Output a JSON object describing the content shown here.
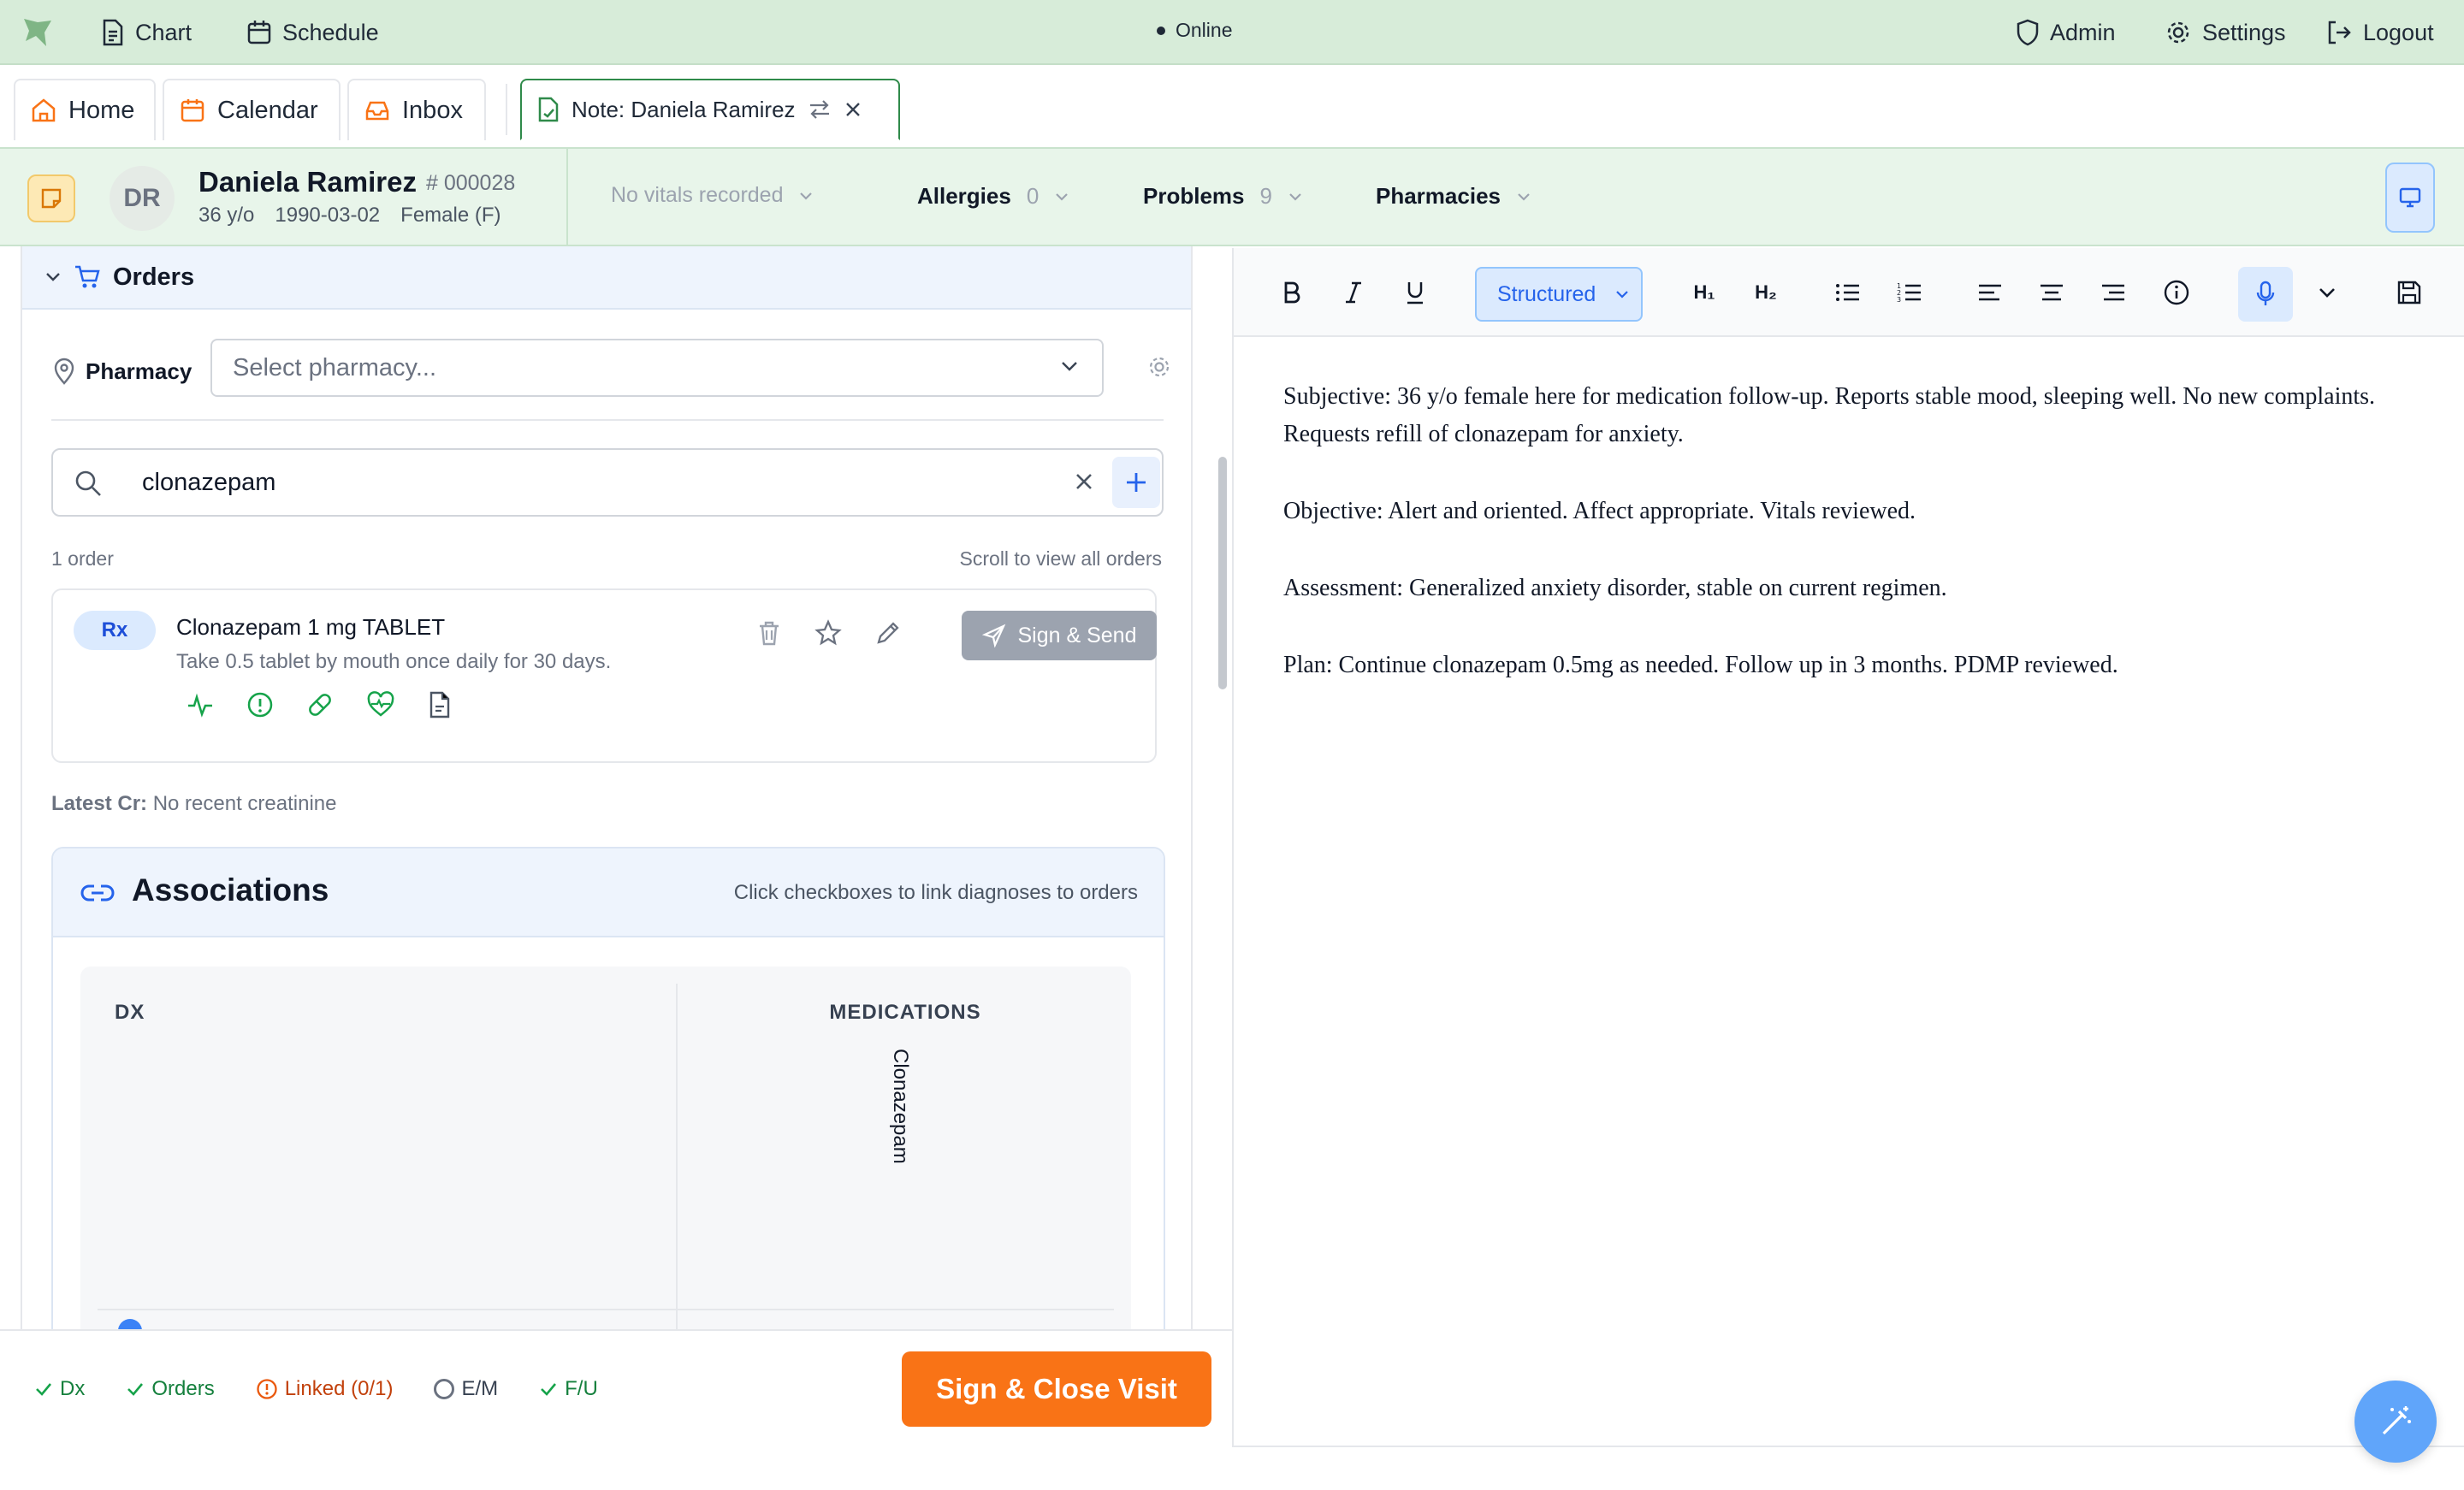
{
  "topbar": {
    "nav": [
      {
        "label": "Chart",
        "icon": "file-text-icon"
      },
      {
        "label": "Schedule",
        "icon": "calendar-icon"
      }
    ],
    "status": "Online",
    "right": [
      {
        "label": "Admin",
        "icon": "shield-icon"
      },
      {
        "label": "Settings",
        "icon": "gear-icon"
      },
      {
        "label": "Logout",
        "icon": "logout-icon"
      }
    ]
  },
  "tabs": [
    {
      "label": "Home",
      "icon": "home-icon"
    },
    {
      "label": "Calendar",
      "icon": "calendar-icon"
    },
    {
      "label": "Inbox",
      "icon": "inbox-icon"
    },
    {
      "label": "Note: Daniela Ramirez",
      "icon": "note-icon",
      "active": true
    }
  ],
  "patient": {
    "initials": "DR",
    "name": "Daniela Ramirez",
    "id": "# 000028",
    "age": "36 y/o",
    "dob": "1990-03-02",
    "sex": "Female (F)",
    "vitals": "No vitals recorded",
    "allergies": {
      "label": "Allergies",
      "count": "0"
    },
    "problems": {
      "label": "Problems",
      "count": "9"
    },
    "pharmacies": {
      "label": "Pharmacies"
    }
  },
  "orders": {
    "title": "Orders",
    "pharmacy_label": "Pharmacy",
    "pharmacy_placeholder": "Select pharmacy...",
    "search_value": "clonazepam",
    "count": "1 order",
    "scroll_hint": "Scroll to view all orders",
    "items": [
      {
        "badge": "Rx",
        "drug": "Clonazepam 1 mg TABLET",
        "sig": "Take 0.5 tablet by mouth once daily for 30 days.",
        "action": "Sign & Send"
      }
    ],
    "latest_cr_label": "Latest Cr:",
    "latest_cr_value": "No recent creatinine"
  },
  "associations": {
    "title": "Associations",
    "hint": "Click checkboxes to link diagnoses to orders",
    "col_dx": "DX",
    "col_medications": "MEDICATIONS",
    "medications": [
      "Clonazepam"
    ]
  },
  "footer": {
    "checks": [
      {
        "label": "Dx",
        "state": "done"
      },
      {
        "label": "Orders",
        "state": "done"
      },
      {
        "label": "Linked (0/1)",
        "state": "warning"
      },
      {
        "label": "E/M",
        "state": "pending"
      },
      {
        "label": "F/U",
        "state": "done"
      }
    ],
    "close_button": "Sign & Close Visit"
  },
  "editor": {
    "toolbar": {
      "mode": "Structured",
      "h1": "H₁",
      "h2": "H₂"
    },
    "paragraphs": [
      "Subjective: 36 y/o female here for medication follow-up. Reports stable mood, sleeping well. No new complaints. Requests refill of clonazepam for anxiety.",
      "Objective: Alert and oriented. Affect appropriate. Vitals reviewed.",
      "Assessment: Generalized anxiety disorder, stable on current regimen.",
      "Plan: Continue clonazepam 0.5mg as needed. Follow up in 3 months. PDMP reviewed."
    ]
  },
  "colors": {
    "topbar": "#d7ecd9",
    "accent_green": "#2f8a4a",
    "accent_orange": "#f97316",
    "accent_blue": "#3b82f6"
  }
}
